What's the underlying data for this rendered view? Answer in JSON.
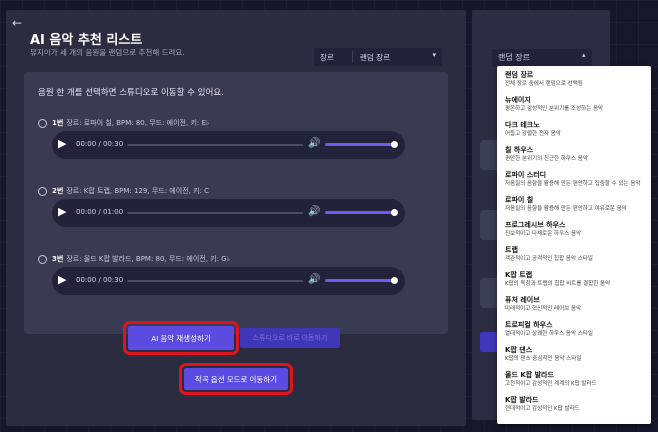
{
  "title": "AI 음악 추천 리스트",
  "subtitle": "뮤지이가 세 개의 음원을 랜덤으로 추천해 드려요.",
  "genre_select": {
    "label": "장르",
    "value": "랜덤 장르",
    "caret": "▾"
  },
  "back_panel": {
    "genre_label": "랜덤 장르",
    "caret": "▴"
  },
  "instruction": "음원 한 개를 선택하면 스튜디오로 이동할 수 있어요.",
  "tracks": [
    {
      "num": "1번",
      "info": "장르: 로파이 칠, BPM: 80, 무드: 에이전, 키: E♭",
      "time": "00:00 / 00:30"
    },
    {
      "num": "2번",
      "info": "장르: K팝 트랩, BPM: 129, 무드: 에이전, 키: C",
      "time": "00:00 / 01:00"
    },
    {
      "num": "3번",
      "info": "장르: 올드 K팝 발라드, BPM: 80, 무드: 에이전, 키: G♭",
      "time": "00:00 / 00:30"
    }
  ],
  "buttons": {
    "generate": "AI 음악 재생성하기",
    "studio": "스튜디오로 바로 이동하기",
    "options": "작곡 옵션 모드로 이동하기"
  },
  "icons": {
    "back": "←",
    "play": "▶",
    "volume": "🔊"
  },
  "colors": {
    "accent": "#5b4be0",
    "highlight": "#e0141e",
    "panel": "#2b2c40"
  },
  "dropdown": [
    {
      "name": "랜덤 장르",
      "desc": "전체 장르 중에서 랜덤으로 선택됨"
    },
    {
      "name": "뉴에이지",
      "desc": "평온하고 감성적인 분위기를 조성하는 음악"
    },
    {
      "name": "다크 테크노",
      "desc": "어둡고 강렬한 전자 음악"
    },
    {
      "name": "칠 하우스",
      "desc": "편안한 분위기의 친근한 하우스 음악"
    },
    {
      "name": "로파이 스터디",
      "desc": "저음질의 음향을 활용해 만든 편안하고 집중할 수 있는 음악"
    },
    {
      "name": "로파이 칠",
      "desc": "저음질의 음향을 활용해 만든 편안하고 여유로운 음악"
    },
    {
      "name": "프로그레시브 하우스",
      "desc": "진보적이고 다채로운 하우스 음악"
    },
    {
      "name": "트랩",
      "desc": "객관적이고 공격적인 힙합 음악 스타일"
    },
    {
      "name": "K팝 트랩",
      "desc": "K팝의 독창과 트랩의 힙합 비트를 결합한 음악"
    },
    {
      "name": "퓨처 레이브",
      "desc": "미래적이고 혁신적인 레이브 음악"
    },
    {
      "name": "트로피컬 하우스",
      "desc": "열대적이고 상쾌한 하우스 음악 스타일"
    },
    {
      "name": "K팝 댄스",
      "desc": "K팝의 댄스 중심적인 음악 스타일"
    },
    {
      "name": "올드 K팝 발라드",
      "desc": "고전적이고 감성적인 계계의 K팝 발라드"
    },
    {
      "name": "K팝 발라드",
      "desc": "현대적이고 감성적인 K팝 발라드"
    }
  ]
}
